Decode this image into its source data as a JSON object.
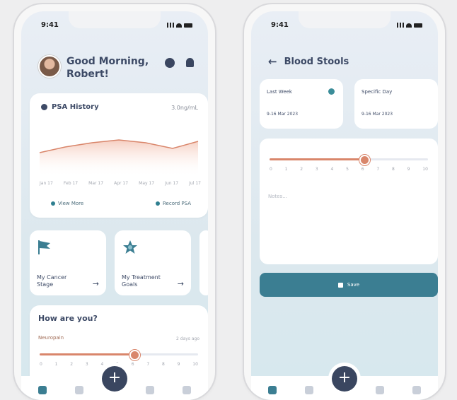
{
  "status": {
    "time": "9:41"
  },
  "left": {
    "greeting": "Good Morning, Robert!",
    "psa": {
      "title": "PSA History",
      "unit": "3.0ng/mL",
      "x_labels": [
        "Jan 17",
        "Feb 17",
        "Mar 17",
        "Apr 17",
        "May 17",
        "Jun 17",
        "Jul 17"
      ],
      "view_more": "View More",
      "record": "Record PSA"
    },
    "tiles": [
      {
        "label": "My Cancer Stage",
        "icon": "flag-icon"
      },
      {
        "label": "My Treatment Goals",
        "icon": "star-icon"
      }
    ],
    "how": {
      "question": "How are you?",
      "symptom": "Neuropain",
      "ago": "2 days ago",
      "level": 6,
      "scale": [
        "0",
        "1",
        "2",
        "3",
        "4",
        "5",
        "6",
        "7",
        "8",
        "9",
        "10"
      ]
    },
    "fab": "+"
  },
  "right": {
    "title": "Blood Stools",
    "back_arrow": "←",
    "last_week": {
      "title": "Last Week",
      "range": "9-16 Mar 2023"
    },
    "specific_day": {
      "title": "Specific Day",
      "range": "9-16 Mar 2023"
    },
    "level": 6,
    "scale": [
      "0",
      "1",
      "2",
      "3",
      "4",
      "5",
      "6",
      "7",
      "8",
      "9",
      "10"
    ],
    "notes_placeholder": "Notes...",
    "save": "Save",
    "fab": "+"
  },
  "colors": {
    "accent": "#3b7e92",
    "slider": "#d9866b",
    "text": "#3d4a66"
  }
}
